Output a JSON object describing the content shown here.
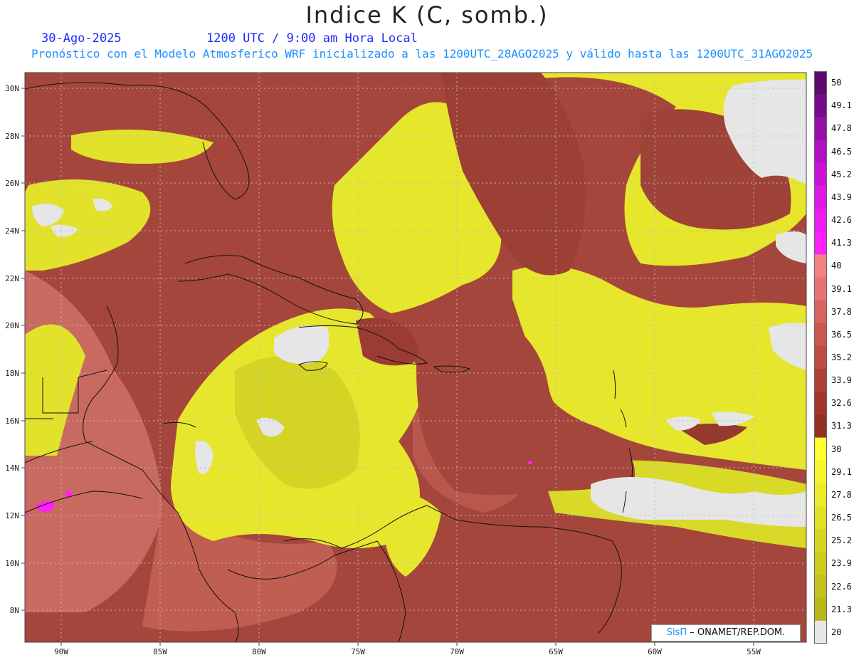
{
  "header": {
    "title": "Indice K (C, somb.)",
    "date": "30-Ago-2025",
    "time": "1200 UTC / 9:00 am Hora Local",
    "subtitle": "Pronóstico con el Modelo Atmosferico WRF inicializado a las 1200UTC_28AGO2025 y válido hasta las  1200UTC_31AGO2025"
  },
  "map": {
    "lat_labels": [
      "30N",
      "28N",
      "26N",
      "24N",
      "22N",
      "20N",
      "18N",
      "16N",
      "14N",
      "12N",
      "10N",
      "8N"
    ],
    "lon_labels": [
      "90W",
      "85W",
      "80W",
      "75W",
      "70W",
      "65W",
      "60W",
      "55W"
    ]
  },
  "legend": {
    "levels": [
      "50",
      "49.1",
      "47.8",
      "46.5",
      "45.2",
      "43.9",
      "42.6",
      "41.3",
      "40",
      "39.1",
      "37.8",
      "36.5",
      "35.2",
      "33.9",
      "32.6",
      "31.3",
      "30",
      "29.1",
      "27.8",
      "26.5",
      "25.2",
      "23.9",
      "22.6",
      "21.3",
      "20"
    ],
    "colors": [
      "#5c0a6e",
      "#7a0a8c",
      "#970fa8",
      "#b30fc4",
      "#cc12d9",
      "#de17e6",
      "#ee1cf2",
      "#ff1fff",
      "#f28282",
      "#e87472",
      "#d9645f",
      "#cc5750",
      "#bf4b43",
      "#b03f37",
      "#a4352d",
      "#963025",
      "#ffff33",
      "#f5f52e",
      "#ebeb2a",
      "#e0e025",
      "#d6d620",
      "#cccc1e",
      "#c2c21a",
      "#b8b816",
      "#e6e6e6"
    ]
  },
  "credit": {
    "brand": "SisΠ",
    "text": "– ONAMET/REP.DOM."
  }
}
